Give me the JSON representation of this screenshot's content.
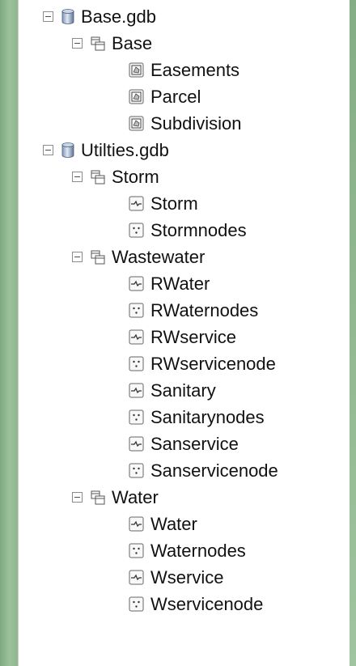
{
  "tree": {
    "items": [
      {
        "label": "Base.gdb",
        "level": 0,
        "type": "database",
        "expanded": true,
        "icon": "database-icon"
      },
      {
        "label": "Base",
        "level": 1,
        "type": "dataset",
        "expanded": true,
        "icon": "feature-dataset-icon"
      },
      {
        "label": "Easements",
        "level": 2,
        "type": "polygon",
        "icon": "polygon-feature-class-icon"
      },
      {
        "label": "Parcel",
        "level": 2,
        "type": "polygon",
        "icon": "polygon-feature-class-icon"
      },
      {
        "label": "Subdivision",
        "level": 2,
        "type": "polygon",
        "icon": "polygon-feature-class-icon"
      },
      {
        "label": "Utilties.gdb",
        "level": 0,
        "type": "database",
        "expanded": true,
        "icon": "database-icon"
      },
      {
        "label": "Storm",
        "level": 1,
        "type": "dataset",
        "expanded": true,
        "icon": "feature-dataset-icon"
      },
      {
        "label": "Storm",
        "level": 2,
        "type": "line",
        "icon": "line-feature-class-icon"
      },
      {
        "label": "Stormnodes",
        "level": 2,
        "type": "point",
        "icon": "point-feature-class-icon"
      },
      {
        "label": "Wastewater",
        "level": 1,
        "type": "dataset",
        "expanded": true,
        "icon": "feature-dataset-icon"
      },
      {
        "label": "RWater",
        "level": 2,
        "type": "line",
        "icon": "line-feature-class-icon"
      },
      {
        "label": "RWaternodes",
        "level": 2,
        "type": "point",
        "icon": "point-feature-class-icon"
      },
      {
        "label": "RWservice",
        "level": 2,
        "type": "line",
        "icon": "line-feature-class-icon"
      },
      {
        "label": "RWservicenode",
        "level": 2,
        "type": "point",
        "icon": "point-feature-class-icon"
      },
      {
        "label": "Sanitary",
        "level": 2,
        "type": "line",
        "icon": "line-feature-class-icon"
      },
      {
        "label": "Sanitarynodes",
        "level": 2,
        "type": "point",
        "icon": "point-feature-class-icon"
      },
      {
        "label": "Sanservice",
        "level": 2,
        "type": "line",
        "icon": "line-feature-class-icon"
      },
      {
        "label": "Sanservicenode",
        "level": 2,
        "type": "point",
        "icon": "point-feature-class-icon"
      },
      {
        "label": "Water",
        "level": 1,
        "type": "dataset",
        "expanded": true,
        "icon": "feature-dataset-icon"
      },
      {
        "label": "Water",
        "level": 2,
        "type": "line",
        "icon": "line-feature-class-icon"
      },
      {
        "label": "Waternodes",
        "level": 2,
        "type": "point",
        "icon": "point-feature-class-icon"
      },
      {
        "label": "Wservice",
        "level": 2,
        "type": "line",
        "icon": "line-feature-class-icon"
      },
      {
        "label": "Wservicenode",
        "level": 2,
        "type": "point",
        "icon": "point-feature-class-icon"
      }
    ]
  },
  "colors": {
    "frame_green": "#8fb58f",
    "panel_bg": "#ffffff",
    "db_blue": "#4a6fa5",
    "icon_border": "#555555"
  }
}
